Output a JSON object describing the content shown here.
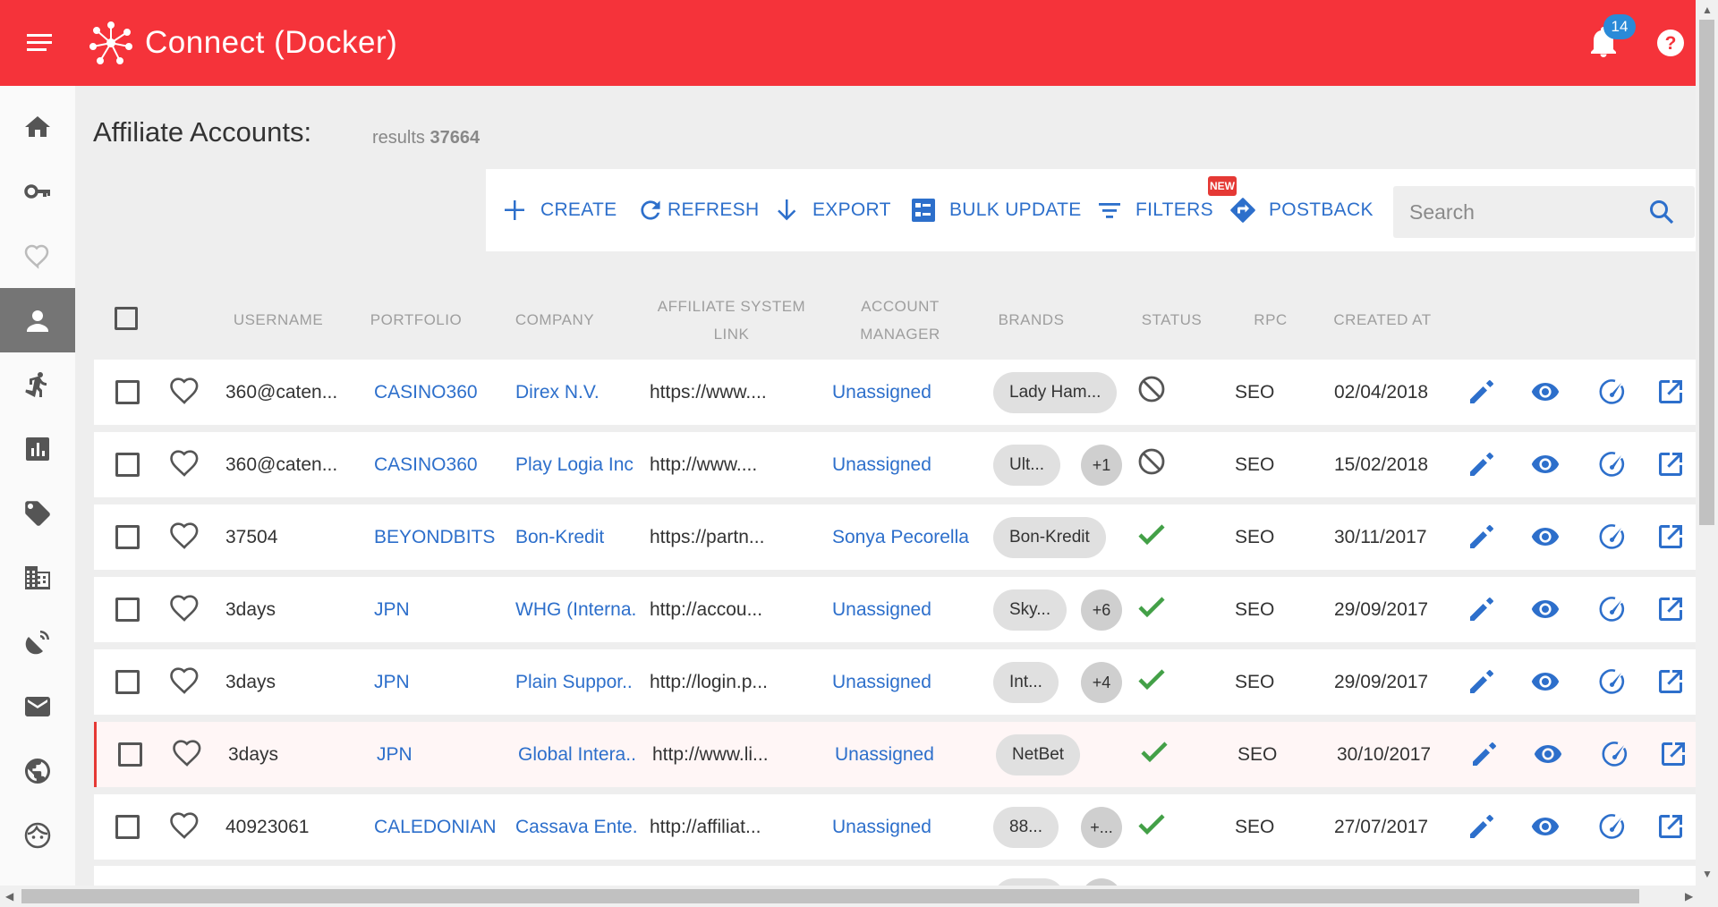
{
  "app": {
    "title": "Connect (Docker)",
    "notifications_count": "14"
  },
  "page": {
    "title": "Affiliate Accounts:",
    "results_label": "results",
    "results_count": "37664"
  },
  "toolbar": {
    "create": "CREATE",
    "refresh": "REFRESH",
    "export": "EXPORT",
    "bulk_update": "BULK UPDATE",
    "filters": "FILTERS",
    "filters_badge": "NEW",
    "postback": "POSTBACK",
    "search_placeholder": "Search"
  },
  "sidebar": {
    "items": [
      {
        "icon": "home-icon"
      },
      {
        "icon": "key-icon"
      },
      {
        "icon": "heart-icon"
      },
      {
        "icon": "person-icon",
        "active": true
      },
      {
        "icon": "runner-icon"
      },
      {
        "icon": "chart-icon"
      },
      {
        "icon": "tag-icon"
      },
      {
        "icon": "building-icon"
      },
      {
        "icon": "satellite-icon"
      },
      {
        "icon": "mail-icon"
      },
      {
        "icon": "globe-icon"
      },
      {
        "icon": "face-icon"
      }
    ]
  },
  "table": {
    "columns": {
      "username": "USERNAME",
      "portfolio": "PORTFOLIO",
      "company": "COMPANY",
      "affiliate_system_link_1": "AFFILIATE SYSTEM",
      "affiliate_system_link_2": "LINK",
      "account_manager_1": "ACCOUNT",
      "account_manager_2": "MANAGER",
      "brands": "BRANDS",
      "status": "STATUS",
      "rpc": "RPC",
      "created_at": "CREATED AT"
    },
    "rows": [
      {
        "username": "360@caten...",
        "portfolio": "CASINO360",
        "company": "Direx N.V.",
        "link": "https://www....",
        "manager": "Unassigned",
        "brand": "Lady Ham...",
        "brand_more": "",
        "status": "blocked",
        "rpc": "SEO",
        "created": "02/04/2018"
      },
      {
        "username": "360@caten...",
        "portfolio": "CASINO360",
        "company": "Play Logia Inc",
        "link": "http://www....",
        "manager": "Unassigned",
        "brand": "Ult...",
        "brand_more": "+1",
        "status": "blocked",
        "rpc": "SEO",
        "created": "15/02/2018"
      },
      {
        "username": "37504",
        "portfolio": "BEYONDBITS",
        "company": "Bon-Kredit",
        "link": "https://partn...",
        "manager": "Sonya Pecorella",
        "brand": "Bon-Kredit",
        "brand_more": "",
        "status": "active",
        "rpc": "SEO",
        "created": "30/11/2017"
      },
      {
        "username": "3days",
        "portfolio": "JPN",
        "company": "WHG (Interna.",
        "link": "http://accou...",
        "manager": "Unassigned",
        "brand": "Sky...",
        "brand_more": "+6",
        "status": "active",
        "rpc": "SEO",
        "created": "29/09/2017"
      },
      {
        "username": "3days",
        "portfolio": "JPN",
        "company": "Plain Suppor..",
        "link": "http://login.p...",
        "manager": "Unassigned",
        "brand": "Int...",
        "brand_more": "+4",
        "status": "active",
        "rpc": "SEO",
        "created": "29/09/2017"
      },
      {
        "username": "3days",
        "portfolio": "JPN",
        "company": "Global Intera..",
        "link": "http://www.li...",
        "manager": "Unassigned",
        "brand": "NetBet",
        "brand_more": "",
        "status": "active",
        "rpc": "SEO",
        "created": "30/10/2017"
      },
      {
        "username": "40923061",
        "portfolio": "CALEDONIAN",
        "company": "Cassava Ente.",
        "link": "http://affiliat...",
        "manager": "Unassigned",
        "brand": "88...",
        "brand_more": "+...",
        "status": "active",
        "rpc": "SEO",
        "created": "27/07/2017"
      }
    ]
  },
  "colors": {
    "brand_red": "#f5333a",
    "link_blue": "#2d6fcb",
    "status_green": "#43a047"
  }
}
